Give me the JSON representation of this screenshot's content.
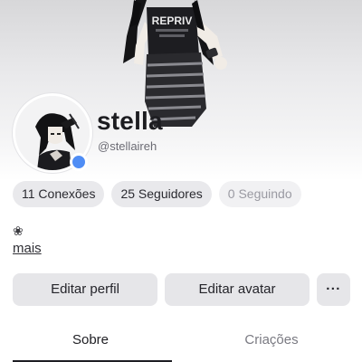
{
  "profile": {
    "display_name": "stella",
    "username": "@stellaireh",
    "online_status_color": "#4f8df5"
  },
  "stats": {
    "connections": "11 Conexões",
    "followers": "25 Seguidores",
    "following": "0 Seguindo"
  },
  "bio": {
    "emoji": "❀",
    "more_label": "mais"
  },
  "actions": {
    "edit_profile": "Editar perfil",
    "edit_avatar": "Editar avatar",
    "more": "···"
  },
  "tabs": [
    {
      "label": "Sobre",
      "active": true
    },
    {
      "label": "Criações",
      "active": false
    }
  ],
  "avatar_shirt_text": "REPRIV"
}
